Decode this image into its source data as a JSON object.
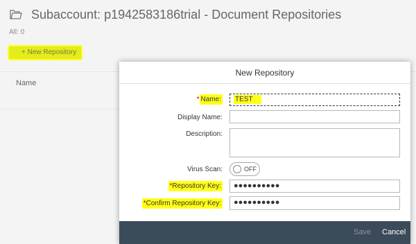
{
  "page": {
    "title": "Subaccount: p1942583186trial - Document Repositories",
    "count": "All: 0",
    "new_button": "+ New Repository",
    "column_name": "Name"
  },
  "dialog": {
    "title": "New Repository",
    "fields": {
      "name_label": "Name:",
      "name_value": "TEST",
      "display_name_label": "Display Name:",
      "description_label": "Description:",
      "virus_scan_label": "Virus Scan:",
      "virus_scan_state": "OFF",
      "repo_key_label": "Repository Key:",
      "repo_key_value": "●●●●●●●●●●",
      "confirm_key_label": "Confirm Repository Key:",
      "confirm_key_value": "●●●●●●●●●●"
    },
    "save_label": "Save",
    "cancel_label": "Cancel"
  },
  "colors": {
    "highlight": "#ffff00",
    "footer": "#3c4b5a",
    "required": "#bb0000"
  }
}
